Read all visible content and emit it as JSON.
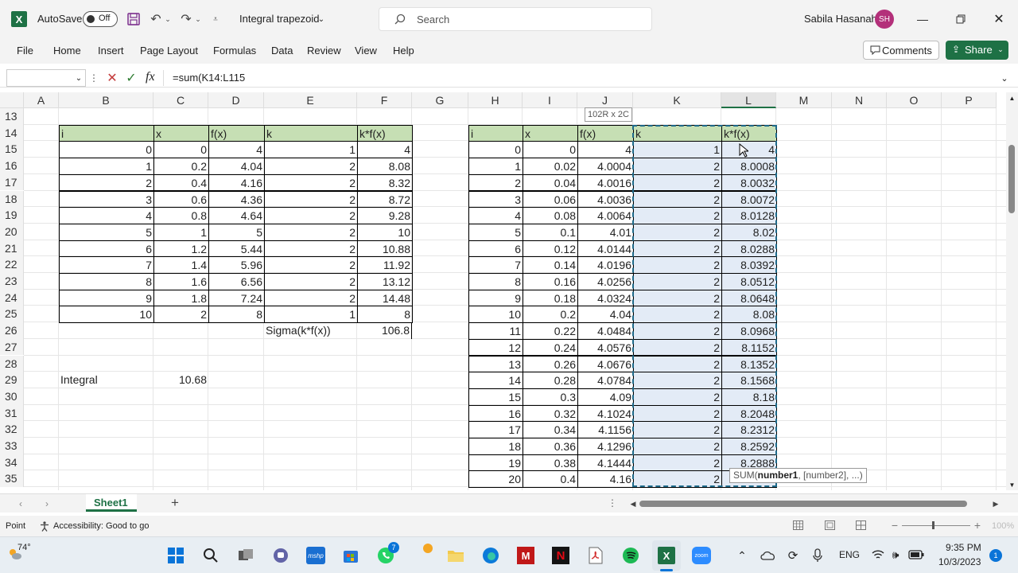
{
  "titlebar": {
    "app_letter": "X",
    "autosave_label": "AutoSave",
    "autosave_state": "Off",
    "doc_title": "Integral trapezoid",
    "search_placeholder": "Search",
    "user_name": "Sabila Hasanah",
    "user_initials": "SH"
  },
  "ribbon": {
    "tabs": [
      "File",
      "Home",
      "Insert",
      "Page Layout",
      "Formulas",
      "Data",
      "Review",
      "View",
      "Help"
    ],
    "comments_label": "Comments",
    "share_label": "Share"
  },
  "formula_bar": {
    "name_box": "",
    "fx": "fx",
    "formula": "=sum(K14:L115"
  },
  "columns": [
    "A",
    "B",
    "C",
    "D",
    "E",
    "F",
    "G",
    "H",
    "I",
    "J",
    "K",
    "L",
    "M",
    "N",
    "O",
    "P"
  ],
  "rows": [
    "13",
    "14",
    "15",
    "16",
    "17",
    "18",
    "19",
    "20",
    "21",
    "22",
    "23",
    "24",
    "25",
    "26",
    "27",
    "28",
    "29",
    "30",
    "31",
    "32",
    "33",
    "34",
    "35"
  ],
  "left_table": {
    "headers": [
      "i",
      "x",
      "f(x)",
      "k",
      "k*f(x)"
    ],
    "data": [
      [
        "0",
        "0",
        "4",
        "1",
        "4"
      ],
      [
        "1",
        "0.2",
        "4.04",
        "2",
        "8.08"
      ],
      [
        "2",
        "0.4",
        "4.16",
        "2",
        "8.32"
      ],
      [
        "3",
        "0.6",
        "4.36",
        "2",
        "8.72"
      ],
      [
        "4",
        "0.8",
        "4.64",
        "2",
        "9.28"
      ],
      [
        "5",
        "1",
        "5",
        "2",
        "10"
      ],
      [
        "6",
        "1.2",
        "5.44",
        "2",
        "10.88"
      ],
      [
        "7",
        "1.4",
        "5.96",
        "2",
        "11.92"
      ],
      [
        "8",
        "1.6",
        "6.56",
        "2",
        "13.12"
      ],
      [
        "9",
        "1.8",
        "7.24",
        "2",
        "14.48"
      ],
      [
        "10",
        "2",
        "8",
        "1",
        "8"
      ]
    ],
    "sigma_label": "Sigma(k*f(x))",
    "sigma_value": "106.8",
    "integral_label": "Integral",
    "integral_value": "10.68"
  },
  "right_table": {
    "headers": [
      "i",
      "x",
      "f(x)",
      "k",
      "k*f(x)"
    ],
    "data": [
      [
        "0",
        "0",
        "4",
        "1",
        "4"
      ],
      [
        "1",
        "0.02",
        "4.0004",
        "2",
        "8.0008"
      ],
      [
        "2",
        "0.04",
        "4.0016",
        "2",
        "8.0032"
      ],
      [
        "3",
        "0.06",
        "4.0036",
        "2",
        "8.0072"
      ],
      [
        "4",
        "0.08",
        "4.0064",
        "2",
        "8.0128"
      ],
      [
        "5",
        "0.1",
        "4.01",
        "2",
        "8.02"
      ],
      [
        "6",
        "0.12",
        "4.0144",
        "2",
        "8.0288"
      ],
      [
        "7",
        "0.14",
        "4.0196",
        "2",
        "8.0392"
      ],
      [
        "8",
        "0.16",
        "4.0256",
        "2",
        "8.0512"
      ],
      [
        "9",
        "0.18",
        "4.0324",
        "2",
        "8.0648"
      ],
      [
        "10",
        "0.2",
        "4.04",
        "2",
        "8.08"
      ],
      [
        "11",
        "0.22",
        "4.0484",
        "2",
        "8.0968"
      ],
      [
        "12",
        "0.24",
        "4.0576",
        "2",
        "8.1152"
      ],
      [
        "13",
        "0.26",
        "4.0676",
        "2",
        "8.1352"
      ],
      [
        "14",
        "0.28",
        "4.0784",
        "2",
        "8.1568"
      ],
      [
        "15",
        "0.3",
        "4.09",
        "2",
        "8.18"
      ],
      [
        "16",
        "0.32",
        "4.1024",
        "2",
        "8.2048"
      ],
      [
        "17",
        "0.34",
        "4.1156",
        "2",
        "8.2312"
      ],
      [
        "18",
        "0.36",
        "4.1296",
        "2",
        "8.2592"
      ],
      [
        "19",
        "0.38",
        "4.1444",
        "2",
        "8.2888"
      ],
      [
        "20",
        "0.4",
        "4.16",
        "2",
        ""
      ]
    ],
    "selection_tooltip": "102R x 2C",
    "fn_tooltip_name": "SUM(",
    "fn_tooltip_arg1": "number1",
    "fn_tooltip_rest": ", [number2], ...)"
  },
  "sheet_tabs": {
    "active": "Sheet1"
  },
  "status": {
    "mode": "Point",
    "accessibility": "Accessibility: Good to go",
    "zoom": "100%"
  },
  "taskbar": {
    "weather": "74°",
    "lang": "ENG",
    "time": "9:35 PM",
    "date": "10/3/2023",
    "notif_count": "1",
    "whatsapp_badge": "7",
    "mcafee_label": "M",
    "netflix_label": "N",
    "mshp_label": "mshp",
    "zoom_label": "zoom",
    "excel_letter": "X"
  },
  "colors": {
    "excel_green": "#1e7145",
    "header_fill": "#c6dfb4",
    "selection_fill": "#e3ebf6",
    "share_green": "#1e7145"
  }
}
